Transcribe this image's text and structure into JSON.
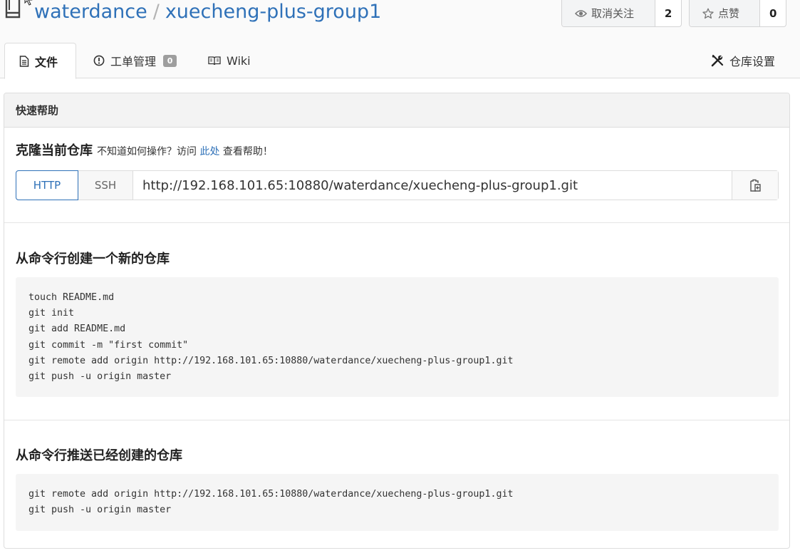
{
  "repo": {
    "owner": "waterdance",
    "separator": "/",
    "name": "xuecheng-plus-group1"
  },
  "watch": {
    "label": "取消关注",
    "count": "2",
    "icon": "eye-icon"
  },
  "star": {
    "label": "点赞",
    "count": "0",
    "icon": "star-icon"
  },
  "tabs": [
    {
      "label": "文件",
      "icon": "file-icon",
      "active": true
    },
    {
      "label": "工单管理",
      "icon": "issue-icon",
      "badge": "0"
    },
    {
      "label": "Wiki",
      "icon": "book-open-icon"
    },
    {
      "label": "仓库设置",
      "icon": "tools-icon"
    }
  ],
  "help": {
    "header": "快速帮助",
    "clone_title": "克隆当前仓库",
    "clone_hint_prefix": "不知道如何操作？访问",
    "clone_hint_link": "此处",
    "clone_hint_suffix": "查看帮助！",
    "protocols": [
      "HTTP",
      "SSH"
    ],
    "clone_url": "http://192.168.101.65:10880/waterdance/xuecheng-plus-group1.git",
    "new_repo_title": "从命令行创建一个新的仓库",
    "new_repo_commands": [
      "touch README.md",
      "git init",
      "git add README.md",
      "git commit -m \"first commit\"",
      "git remote add origin http://192.168.101.65:10880/waterdance/xuecheng-plus-group1.git",
      "git push -u origin master"
    ],
    "push_existing_title": "从命令行推送已经创建的仓库",
    "push_existing_commands": [
      "git remote add origin http://192.168.101.65:10880/waterdance/xuecheng-plus-group1.git",
      "git push -u origin master"
    ]
  },
  "colors": {
    "link": "#2f71b8",
    "header_bg": "#fafafa",
    "code_bg": "#f5f5f5",
    "badge_bg": "#9e9e9e"
  }
}
